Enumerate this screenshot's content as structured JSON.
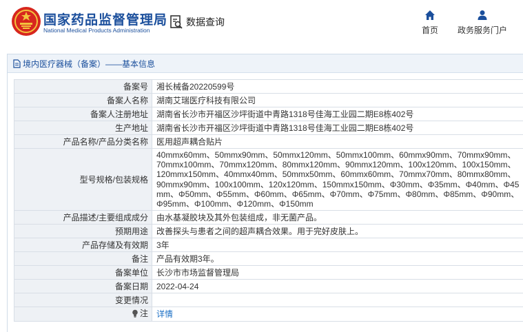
{
  "header": {
    "brand_cn": "国家药品监督管理局",
    "brand_en": "National Medical Products Administration",
    "data_query": "数据查询",
    "nav": [
      {
        "label": "首页",
        "icon": "home-icon"
      },
      {
        "label": "政务服务门户",
        "icon": "user-icon"
      }
    ]
  },
  "panel": {
    "breadcrumb": "境内医疗器械（备案）——基本信息"
  },
  "rows": [
    {
      "label": "备案号",
      "value": "湘长械备20220599号"
    },
    {
      "label": "备案人名称",
      "value": "湖南艾瑞医疗科技有限公司"
    },
    {
      "label": "备案人注册地址",
      "value": "湖南省长沙市开福区沙坪街道中青路1318号佳海工业园二期E8栋402号"
    },
    {
      "label": "生产地址",
      "value": "湖南省长沙市开福区沙坪街道中青路1318号佳海工业园二期E8栋402号"
    },
    {
      "label": "产品名称/产品分类名称",
      "value": "医用超声耦合贴片"
    },
    {
      "label": "型号规格/包装规格",
      "value": "40mmx60mm、50mmx90mm、50mmx120mm、50mmx100mm、60mmx90mm、70mmx90mm、70mmx100mm、70mmx120mm、80mmx120mm、90mmx120mm、100x120mm、100x150mm、120mmx150mm、40mmx40mm、50mmx50mm、60mmx60mm、70mmx70mm、80mmx80mm、90mmx90mm、100x100mm、120x120mm、150mmx150mm、Φ30mm、Φ35mm、Φ40mm、Φ45mm、Φ50mm、Φ55mm、Φ60mm、Φ65mm、Φ70mm、Φ75mm、Φ80mm、Φ85mm、Φ90mm、Φ95mm、Φ100mm、Φ120mm、Φ150mm"
    },
    {
      "label": "产品描述/主要组成成分",
      "value": "由水基凝胶块及其外包装组成，非无菌产品。"
    },
    {
      "label": "预期用途",
      "value": "改善探头与患者之间的超声耦合效果。用于完好皮肤上。"
    },
    {
      "label": "产品存储及有效期",
      "value": "3年"
    },
    {
      "label": "备注",
      "value": "产品有效期3年。"
    },
    {
      "label": "备案单位",
      "value": "长沙市市场监督管理局"
    },
    {
      "label": "备案日期",
      "value": "2022-04-24"
    },
    {
      "label": "变更情况",
      "value": ""
    },
    {
      "label": "注",
      "value": "详情",
      "icon": "lightbulb-icon"
    }
  ],
  "colors": {
    "brand_blue": "#1b4f9c",
    "logo_red": "#d7261e",
    "label_bg": "#eef1f5",
    "link": "#1b6fc4"
  }
}
